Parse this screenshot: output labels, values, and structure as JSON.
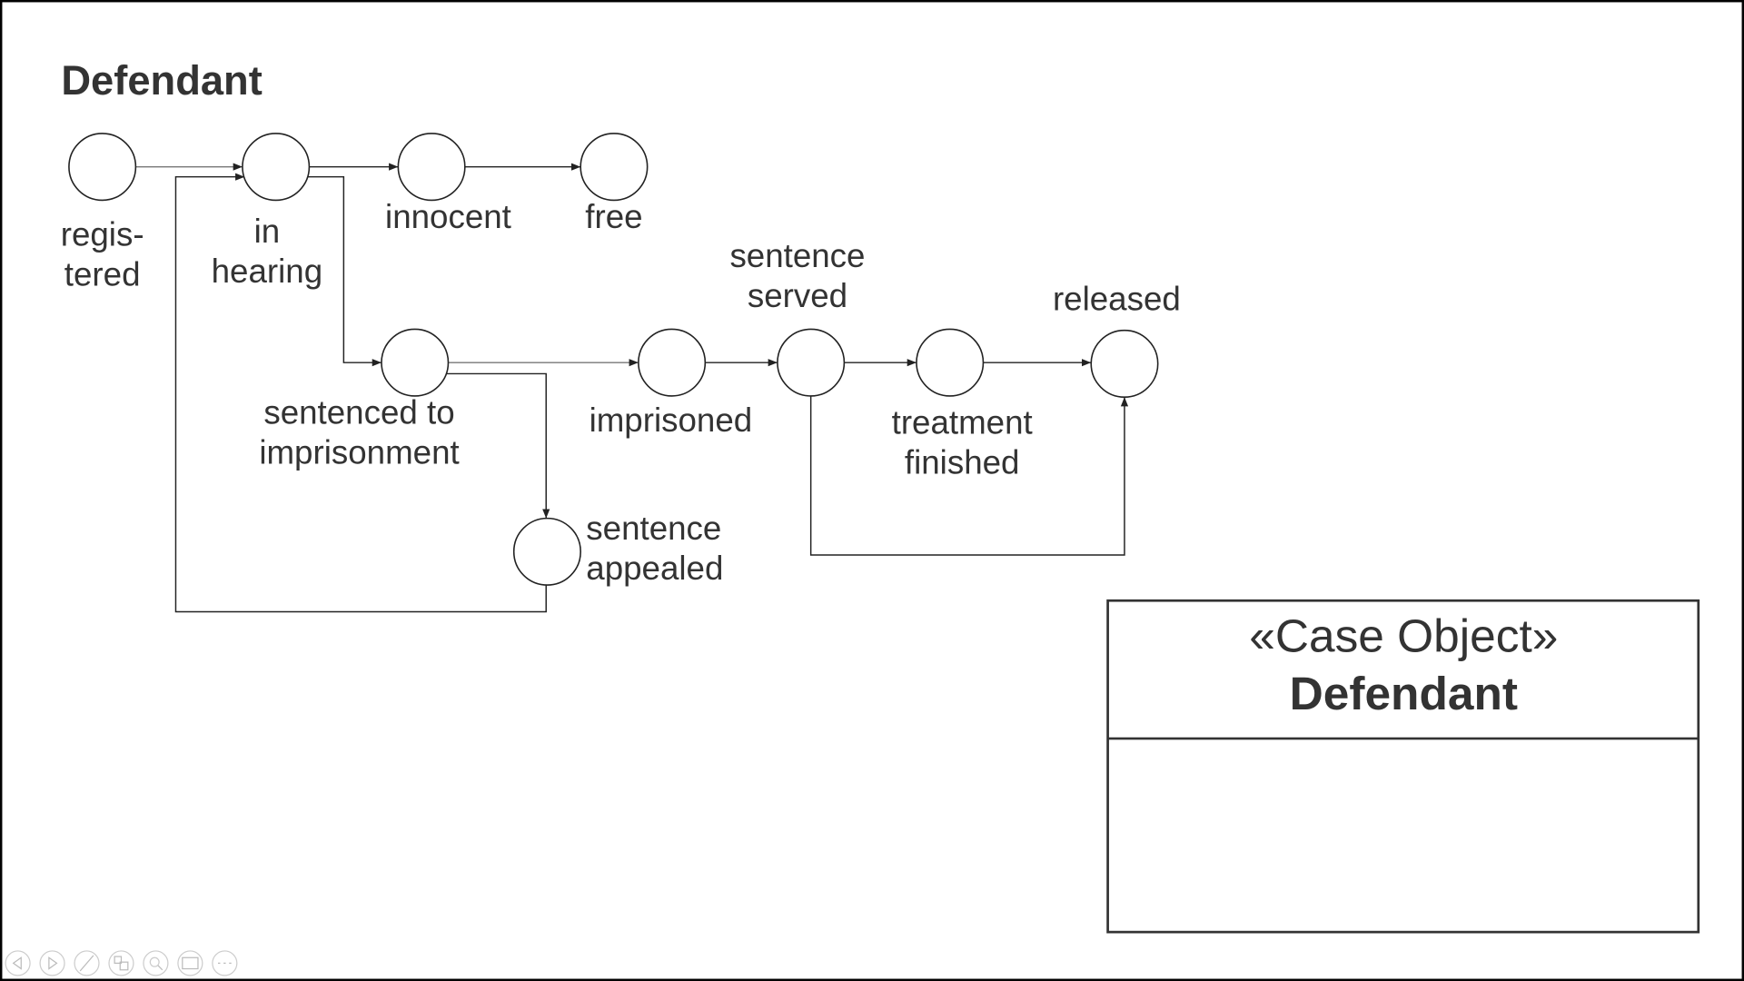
{
  "diagram": {
    "title": "Defendant",
    "states": [
      {
        "id": "registered",
        "lines": [
          "regis-",
          "tered"
        ]
      },
      {
        "id": "in-hearing",
        "lines": [
          "in",
          "hearing"
        ]
      },
      {
        "id": "innocent",
        "lines": [
          "innocent"
        ]
      },
      {
        "id": "free",
        "lines": [
          "free"
        ]
      },
      {
        "id": "sentenced-to-imprisonment",
        "lines": [
          "sentenced to",
          "imprisonment"
        ]
      },
      {
        "id": "imprisoned",
        "lines": [
          "imprisoned"
        ]
      },
      {
        "id": "sentence-served",
        "lines": [
          "sentence",
          "served"
        ]
      },
      {
        "id": "treatment-finished",
        "lines": [
          "treatment",
          "finished"
        ]
      },
      {
        "id": "released",
        "lines": [
          "released"
        ]
      },
      {
        "id": "sentence-appealed",
        "lines": [
          "sentence",
          "appealed"
        ]
      }
    ],
    "transitions": [
      [
        "registered",
        "in-hearing"
      ],
      [
        "in-hearing",
        "innocent"
      ],
      [
        "innocent",
        "free"
      ],
      [
        "in-hearing",
        "sentenced-to-imprisonment"
      ],
      [
        "sentenced-to-imprisonment",
        "imprisoned"
      ],
      [
        "imprisoned",
        "sentence-served"
      ],
      [
        "sentence-served",
        "treatment-finished"
      ],
      [
        "treatment-finished",
        "released"
      ],
      [
        "sentenced-to-imprisonment",
        "sentence-appealed"
      ],
      [
        "sentence-appealed",
        "in-hearing"
      ],
      [
        "sentence-served",
        "released"
      ]
    ],
    "case_object": {
      "stereotype": "«Case Object»",
      "name": "Defendant"
    }
  },
  "toolbar": {
    "icons": [
      "previous-icon",
      "next-icon",
      "pen-icon",
      "slides-icon",
      "zoom-icon",
      "subtitles-icon",
      "more-icon"
    ]
  }
}
